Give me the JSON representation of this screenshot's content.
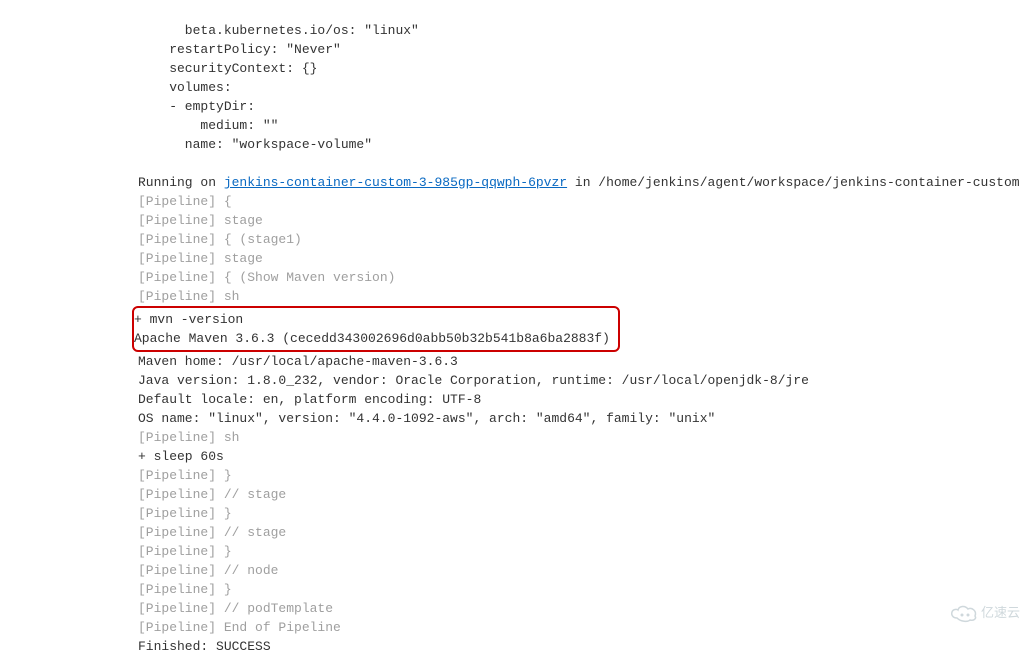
{
  "yaml": {
    "l1": "      beta.kubernetes.io/os: \"linux\"",
    "l2": "    restartPolicy: \"Never\"",
    "l3": "    securityContext: {}",
    "l4": "    volumes:",
    "l5": "    - emptyDir:",
    "l6": "        medium: \"\"",
    "l7": "      name: \"workspace-volume\""
  },
  "run": {
    "prefix": "Running on ",
    "link": "jenkins-container-custom-3-985gp-qqwph-6pvzr",
    "suffix": " in /home/jenkins/agent/workspace/jenkins-container-custom"
  },
  "pipe": {
    "open": "[Pipeline] {",
    "stage": "[Pipeline] stage",
    "stage1": "[Pipeline] { (stage1)",
    "stage2": "[Pipeline] stage",
    "mvnStage": "[Pipeline] { (Show Maven version)",
    "sh1": "[Pipeline] sh",
    "mvnCmd": "+ mvn -version",
    "mvnResult": "Apache Maven 3.6.3 (cecedd343002696d0abb50b32b541b8a6ba2883f)",
    "mvnHome": "Maven home: /usr/local/apache-maven-3.6.3",
    "java": "Java version: 1.8.0_232, vendor: Oracle Corporation, runtime: /usr/local/openjdk-8/jre",
    "locale": "Default locale: en, platform encoding: UTF-8",
    "os": "OS name: \"linux\", version: \"4.4.0-1092-aws\", arch: \"amd64\", family: \"unix\"",
    "sh2": "[Pipeline] sh",
    "sleep": "+ sleep 60s",
    "close1": "[Pipeline] }",
    "endStage1": "[Pipeline] // stage",
    "close2": "[Pipeline] }",
    "endStage2": "[Pipeline] // stage",
    "close3": "[Pipeline] }",
    "endNode": "[Pipeline] // node",
    "close4": "[Pipeline] }",
    "endPod": "[Pipeline] // podTemplate",
    "endPipeline": "[Pipeline] End of Pipeline",
    "finished": "Finished: SUCCESS"
  },
  "watermark": {
    "text": "亿速云"
  }
}
